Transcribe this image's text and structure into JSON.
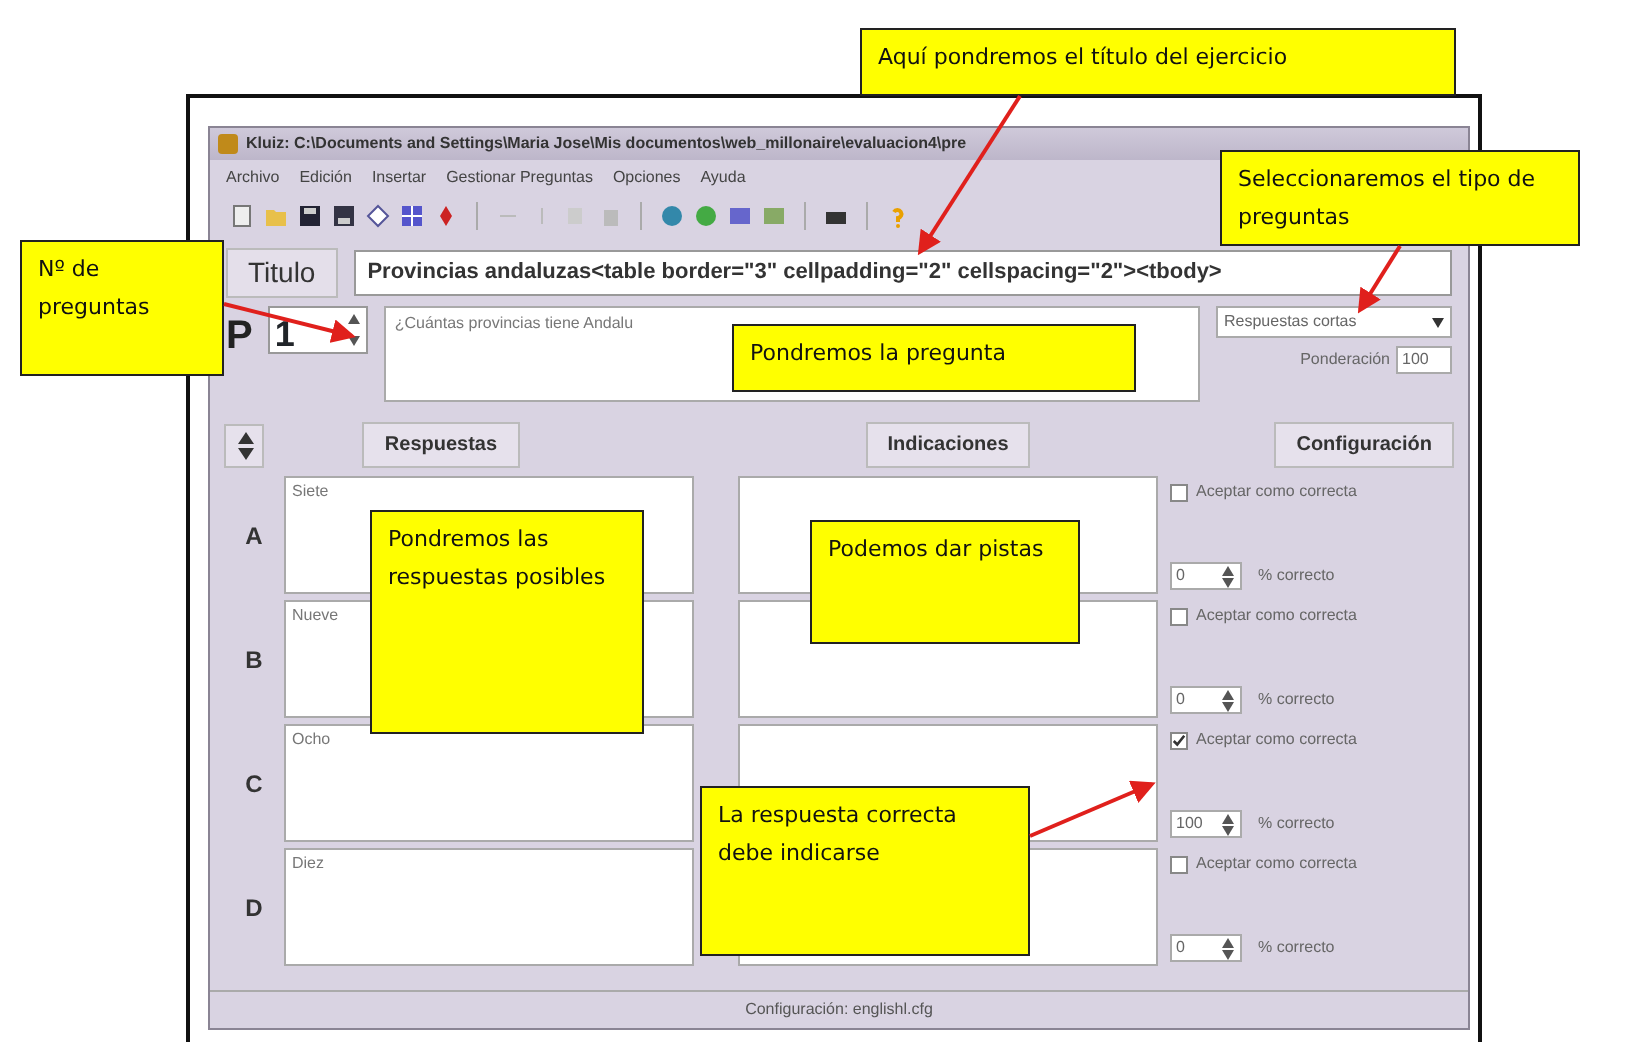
{
  "window": {
    "title": "Kluiz: C:\\Documents and Settings\\Maria Jose\\Mis documentos\\web_millonaire\\evaluacion4\\pre"
  },
  "menu": [
    "Archivo",
    "Edición",
    "Insertar",
    "Gestionar Preguntas",
    "Opciones",
    "Ayuda"
  ],
  "title_field": {
    "label": "Titulo",
    "value": "Provincias andaluzas<table border=\"3\" cellpadding=\"2\" cellspacing=\"2\"><tbody>"
  },
  "question": {
    "label": "P",
    "number": "1",
    "text": "¿Cuántas provincias tiene Andalu",
    "type": "Respuestas cortas",
    "weight_label": "Ponderación",
    "weight": "100"
  },
  "headers": [
    "Respuestas",
    "Indicaciones",
    "Configuración"
  ],
  "answers": [
    {
      "letter": "A",
      "text": "Siete",
      "accept_label": "Aceptar como correcta",
      "checked": false,
      "percent": "0",
      "percent_label": "% correcto"
    },
    {
      "letter": "B",
      "text": "Nueve",
      "accept_label": "Aceptar como correcta",
      "checked": false,
      "percent": "0",
      "percent_label": "% correcto"
    },
    {
      "letter": "C",
      "text": "Ocho",
      "accept_label": "Aceptar como correcta",
      "checked": true,
      "percent": "100",
      "percent_label": "% correcto"
    },
    {
      "letter": "D",
      "text": "Diez",
      "accept_label": "Aceptar como correcta",
      "checked": false,
      "percent": "0",
      "percent_label": "% correcto"
    }
  ],
  "status_bar": "Configuración: englishl.cfg",
  "annotations": [
    {
      "text": "Aquí pondremos el título del ejercicio",
      "arrow": true
    },
    {
      "text": "Nº de preguntas",
      "arrow": true
    },
    {
      "text": "Seleccionaremos el tipo de preguntas",
      "arrow": true
    },
    {
      "text": "Pondremos la pregunta",
      "arrow": false
    },
    {
      "text": "Pondremos las respuestas posibles",
      "arrow": false
    },
    {
      "text": "Podemos dar pistas",
      "arrow": false
    },
    {
      "text": "La respuesta correcta debe indicarse",
      "arrow": true
    }
  ]
}
